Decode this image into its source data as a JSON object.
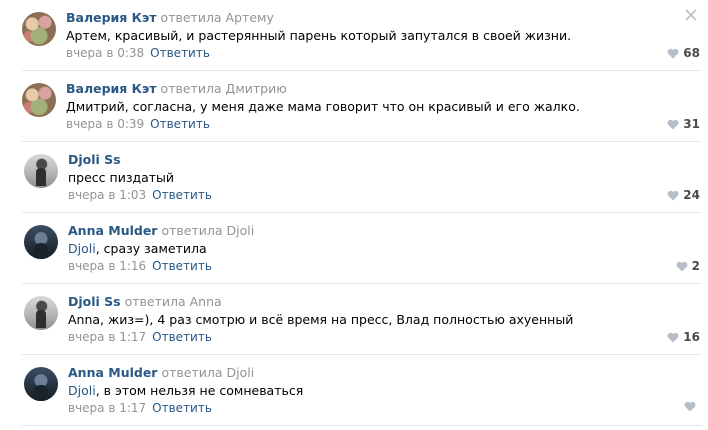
{
  "comments": [
    {
      "author": "Валерия Кэт",
      "replied": "ответила Артему",
      "mention": "",
      "text": "Артем, красивый, и растерянный парень который запутался в своей жизни.",
      "time": "вчера в 0:38",
      "reply": "Ответить",
      "likes": "68",
      "avatar": "flowers"
    },
    {
      "author": "Валерия Кэт",
      "replied": "ответила Дмитрию",
      "mention": "",
      "text": "Дмитрий, согласна, у меня даже мама говорит что он красивый и его жалко.",
      "time": "вчера в 0:39",
      "reply": "Ответить",
      "likes": "31",
      "avatar": "flowers"
    },
    {
      "author": "Djoli Ss",
      "replied": "",
      "mention": "",
      "text": "пресс пиздатый",
      "time": "вчера в 1:03",
      "reply": "Ответить",
      "likes": "24",
      "avatar": "gray"
    },
    {
      "author": "Anna Mulder",
      "replied": "ответила Djoli",
      "mention": "Djoli",
      "text": ", сразу заметила",
      "time": "вчера в 1:16",
      "reply": "Ответить",
      "likes": "2",
      "avatar": "blue"
    },
    {
      "author": "Djoli Ss",
      "replied": "ответила Anna",
      "mention": "",
      "text": "Anna, жиз=), 4 раз смотрю и всё время на пресс, Влад полностью ахуенный",
      "time": "вчера в 1:17",
      "reply": "Ответить",
      "likes": "16",
      "avatar": "gray"
    },
    {
      "author": "Anna Mulder",
      "replied": "ответила Djoli",
      "mention": "Djoli",
      "text": ", в этом нельзя не сомневаться",
      "time": "вчера в 1:17",
      "reply": "Ответить",
      "likes": "",
      "avatar": "blue"
    }
  ],
  "icons": {
    "like": "heart-icon",
    "close": "close-icon"
  },
  "colors": {
    "link": "#2a5885",
    "meta": "#939393",
    "divider": "#e7e8ec"
  }
}
